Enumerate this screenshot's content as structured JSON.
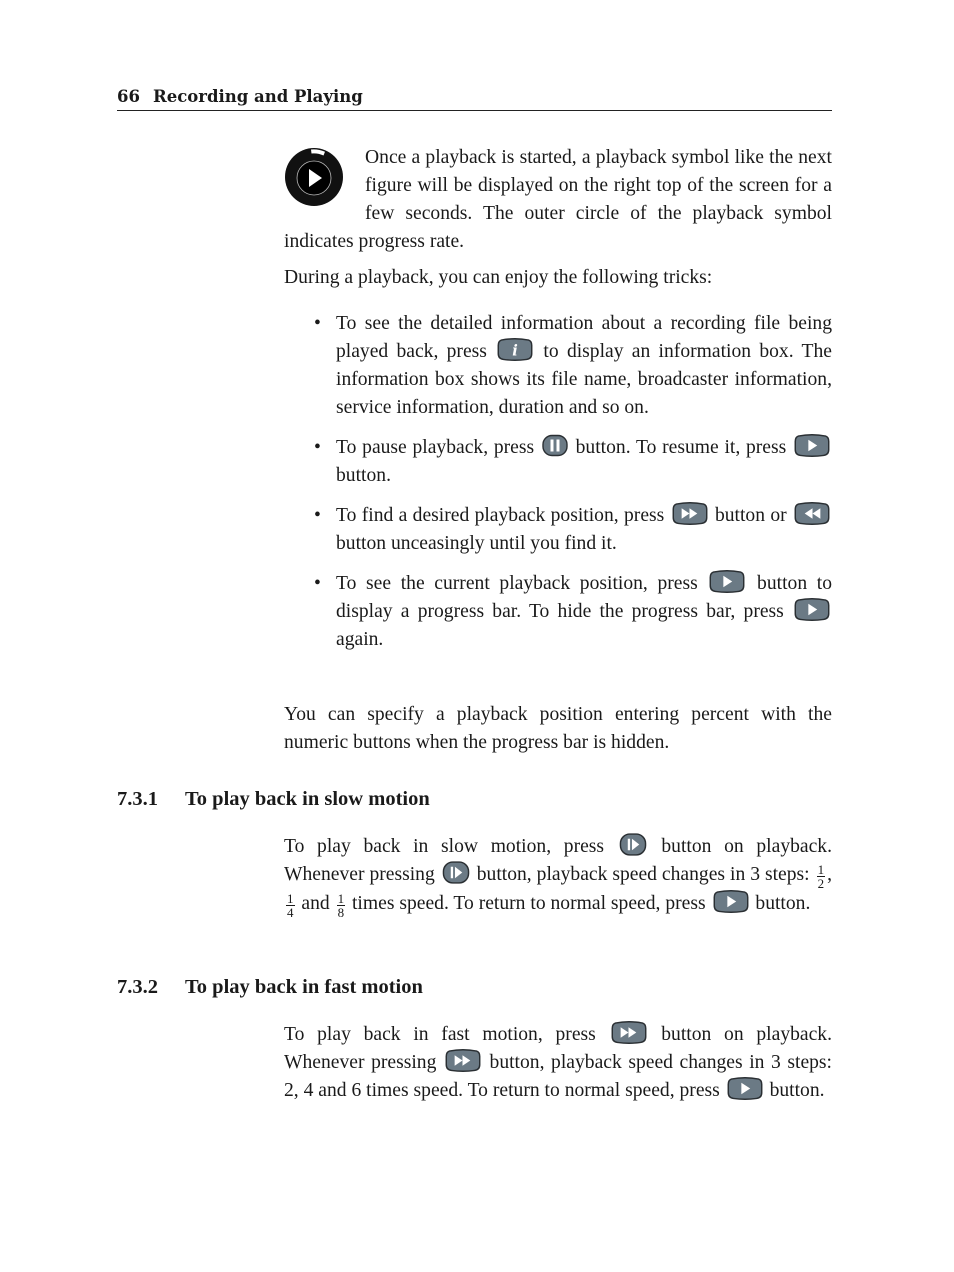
{
  "running_head": {
    "page_number": "66",
    "chapter_title": "Recording and Playing"
  },
  "intro": {
    "figure_icon": "playback-progress-symbol",
    "text": "Once a playback is started, a playback symbol like the next figure will be displayed on the right top of the screen for a few seconds. The outer circle of the playback symbol indicates progress rate."
  },
  "tricks_intro": "During a playback, you can enjoy the following tricks:",
  "bullets": [
    {
      "parts": [
        "To see the detailed information about a recording file being played back, press ",
        " to display an information box. The information box shows its file name, broadcaster information, service information, duration and so on."
      ],
      "icons": [
        "info-button"
      ]
    },
    {
      "parts": [
        "To pause playback, press ",
        " button. To resume it, press ",
        " button."
      ],
      "icons": [
        "pause-button",
        "play-button"
      ]
    },
    {
      "parts": [
        "To find a desired playback position, press ",
        " button or ",
        " button unceasingly until you find it."
      ],
      "icons": [
        "fast-forward-button",
        "rewind-button"
      ]
    },
    {
      "parts": [
        "To see the current playback position, press ",
        " button to display a progress bar. To hide the progress bar, press ",
        " again."
      ],
      "icons": [
        "play-button",
        "play-button"
      ]
    }
  ],
  "position_note": "You can specify a playback position entering percent with the numeric buttons when the progress bar is hidden.",
  "sections": [
    {
      "number": "7.3.1",
      "title": "To play back in slow motion",
      "p1": "To play back in slow motion, press ",
      "p2": " button on playback. Whenever pressing ",
      "p3": " button, playback speed changes in 3 steps: ",
      "fractions": [
        {
          "num": "1",
          "den": "2"
        },
        {
          "num": "1",
          "den": "4"
        },
        {
          "num": "1",
          "den": "8"
        }
      ],
      "sep1": ", ",
      "sep2": " and ",
      "p4": " times speed.  To return to normal speed, press ",
      "p5": " button."
    },
    {
      "number": "7.3.2",
      "title": "To play back in fast motion",
      "p1": "To play back in fast motion, press ",
      "p2": " button on playback. Whenever pressing ",
      "p3": " button, playback speed changes in 3 steps: 2, 4 and 6 times speed. To return to normal speed, press ",
      "p4": " button."
    }
  ],
  "colors": {
    "button_fill": "#6b7a85",
    "button_outline": "#2a2f33",
    "glyph": "#ffffff",
    "symbol_dark": "#111111"
  }
}
